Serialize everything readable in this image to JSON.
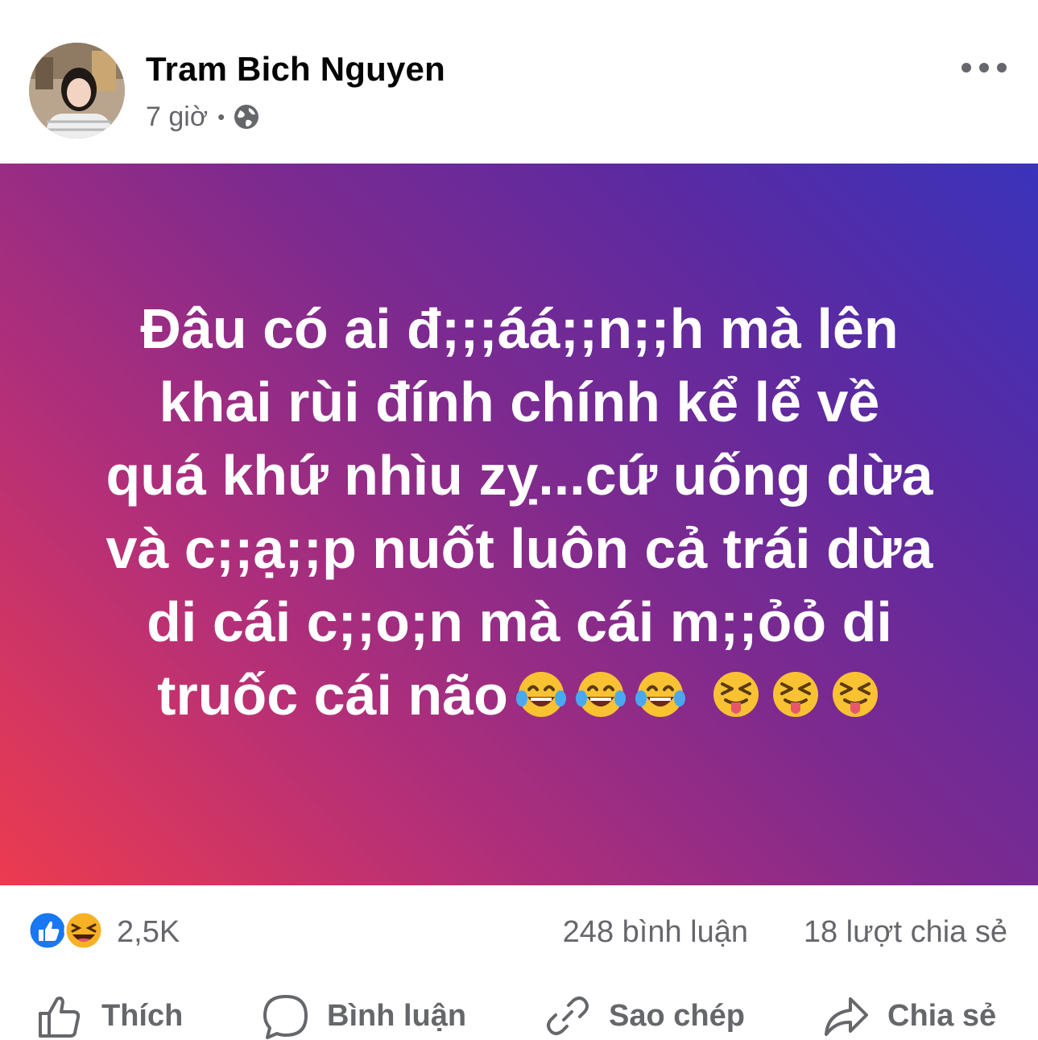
{
  "post": {
    "author_name": "Tram Bich Nguyen",
    "timestamp": "7 giờ",
    "separator": "•",
    "privacy_icon": "globe-icon",
    "more_icon": "more-options-icon",
    "status_lines": [
      "Đâu có ai đ;;;áá;;n;;h  mà lên",
      "khai rùi đính chính kể lể về",
      "quá khứ nhìu zỵ...cứ uống dừa",
      "và c;;ạ;;p nuốt luôn cả trái dừa",
      "di cái c;;o;n mà cái m;;ỏỏ di",
      "truốc cái não"
    ],
    "status_emojis": [
      "laughing-tears-emoji",
      "laughing-tears-emoji",
      "laughing-tears-emoji",
      "squinting-tongue-emoji",
      "squinting-tongue-emoji",
      "squinting-tongue-emoji"
    ],
    "background_colors": {
      "start": "#ec3b4f",
      "middle": "#7d2a8f",
      "end": "#3a33bb"
    }
  },
  "stats": {
    "reaction_icons": [
      "like-reaction-icon",
      "haha-reaction-icon"
    ],
    "reaction_count": "2,5K",
    "comments": "248 bình luận",
    "shares": "18 lượt chia sẻ"
  },
  "actions": {
    "like_label": "Thích",
    "comment_label": "Bình luận",
    "copy_label": "Sao chép",
    "share_label": "Chia sẻ"
  },
  "colors": {
    "secondary_text": "#65676b",
    "like_blue": "#1877f2",
    "haha_yellow": "#f7b125"
  }
}
